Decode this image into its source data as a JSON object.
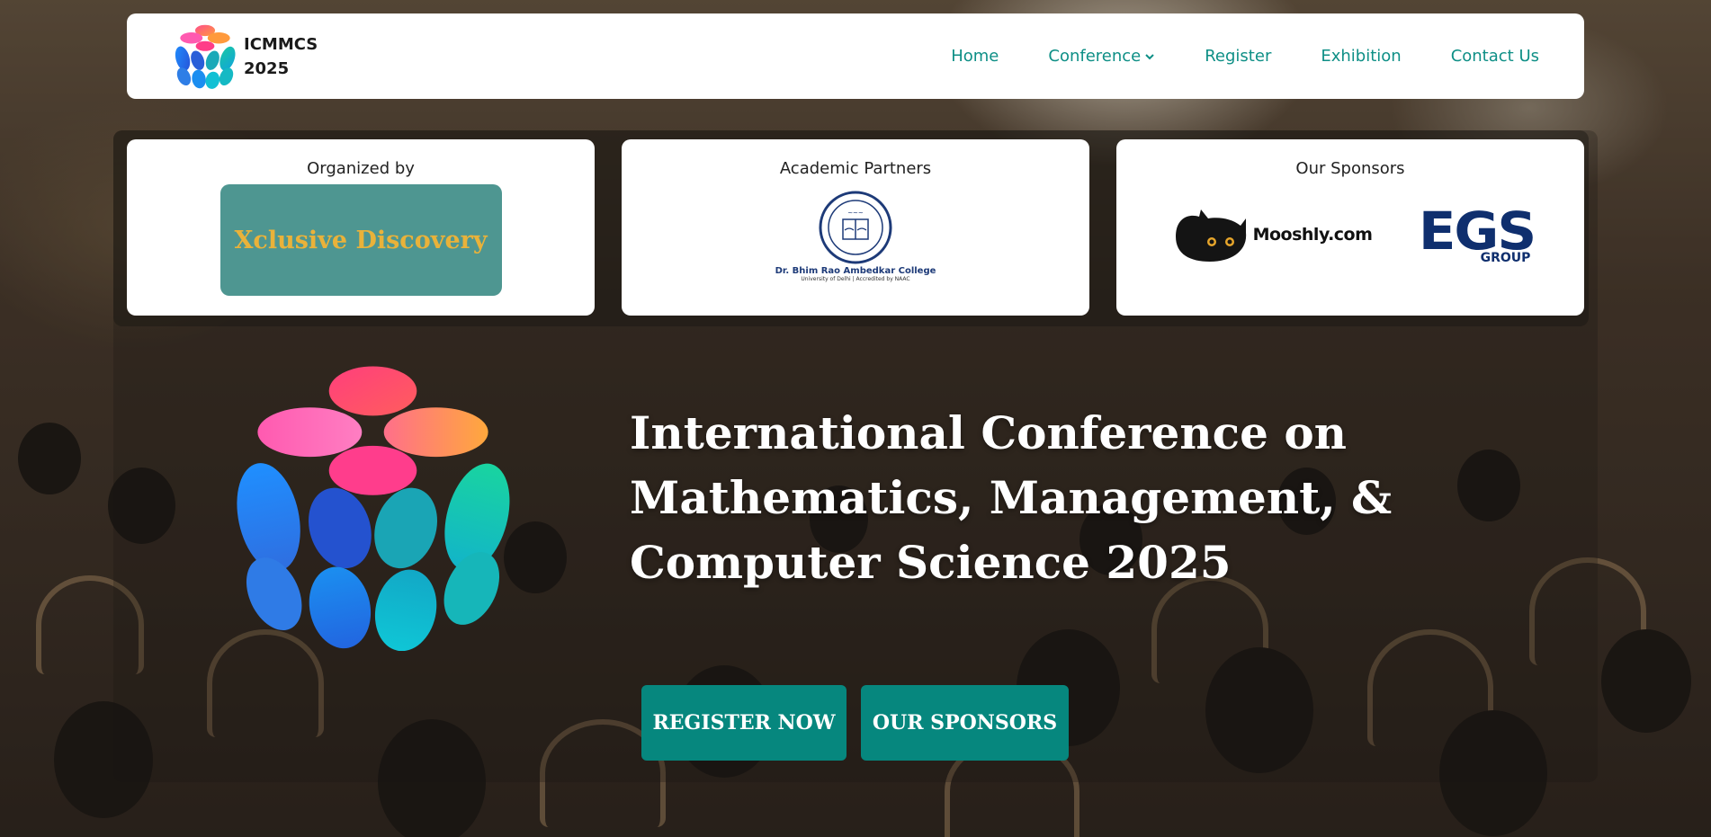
{
  "header": {
    "brand_line1": "ICMMCS",
    "brand_line2": "2025",
    "nav": [
      {
        "label": "Home"
      },
      {
        "label": "Conference"
      },
      {
        "label": "Register"
      },
      {
        "label": "Exhibition"
      },
      {
        "label": "Contact Us"
      }
    ]
  },
  "cards": {
    "organized": {
      "title": "Organized by",
      "org_name": "Xclusive Discovery"
    },
    "academic": {
      "title": "Academic Partners",
      "college_name": "Dr. Bhim Rao Ambedkar College",
      "college_sub": "University of Delhi | Accredited by NAAC"
    },
    "sponsors": {
      "title": "Our Sponsors",
      "sponsor1": "Mooshly.com",
      "sponsor2_main": "EGS",
      "sponsor2_sub": "GROUP"
    }
  },
  "hero": {
    "title": "International Conference on Mathematics, Management, & Computer Science 2025",
    "register_label": "REGISTER NOW",
    "sponsors_label": "OUR SPONSORS"
  },
  "colors": {
    "accent": "#0e8f86",
    "button": "#06877e",
    "org_box": "#4e9691",
    "org_text": "#e9b23a",
    "egs_blue": "#0f2f6e"
  },
  "icons": [
    "conference-logo",
    "chevron-down-icon",
    "college-emblem",
    "mooshly-cat-icon"
  ]
}
